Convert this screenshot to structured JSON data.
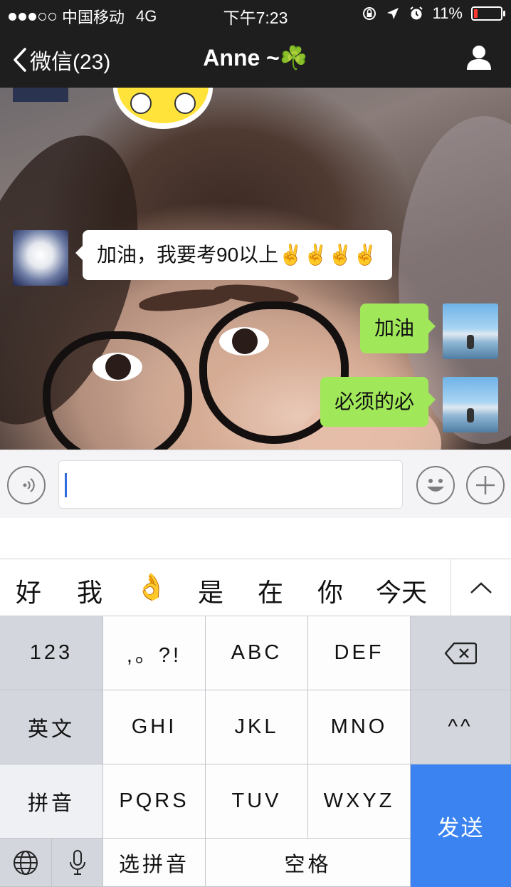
{
  "status_bar": {
    "carrier": "中国移动",
    "network": "4G",
    "time": "下午7:23",
    "battery": "11%",
    "signal_bars_filled": 3,
    "signal_bars_total": 5
  },
  "nav": {
    "back_label": "微信(23)",
    "title": "Anne ~☘️"
  },
  "messages": [
    {
      "side": "in",
      "avatar": "cat-avatar",
      "text": "加油，我要考90以上✌️✌️✌️✌️"
    },
    {
      "side": "out",
      "avatar": "sea-avatar",
      "text": "加油"
    },
    {
      "side": "out",
      "avatar": "sea-avatar",
      "text": "必须的必"
    }
  ],
  "input": {
    "value": "",
    "placeholder": ""
  },
  "candidates": [
    "好",
    "我",
    "👌",
    "是",
    "在",
    "你",
    "今天"
  ],
  "keyboard": {
    "row1": [
      "123",
      ",。?!",
      "ABC",
      "DEF"
    ],
    "row2": [
      "英文",
      "GHI",
      "JKL",
      "MNO",
      "^^"
    ],
    "row3": [
      "拼音",
      "PQRS",
      "TUV",
      "WXYZ"
    ],
    "row4": [
      "选拼音",
      "空格"
    ],
    "send": "发送"
  },
  "colors": {
    "nav_bg": "#1e1e1e",
    "incoming_bubble": "#ffffff",
    "outgoing_bubble": "#a0e75a",
    "send_key": "#3a83f1",
    "battery_low": "#ff3b30",
    "caret": "#2f6de1"
  }
}
